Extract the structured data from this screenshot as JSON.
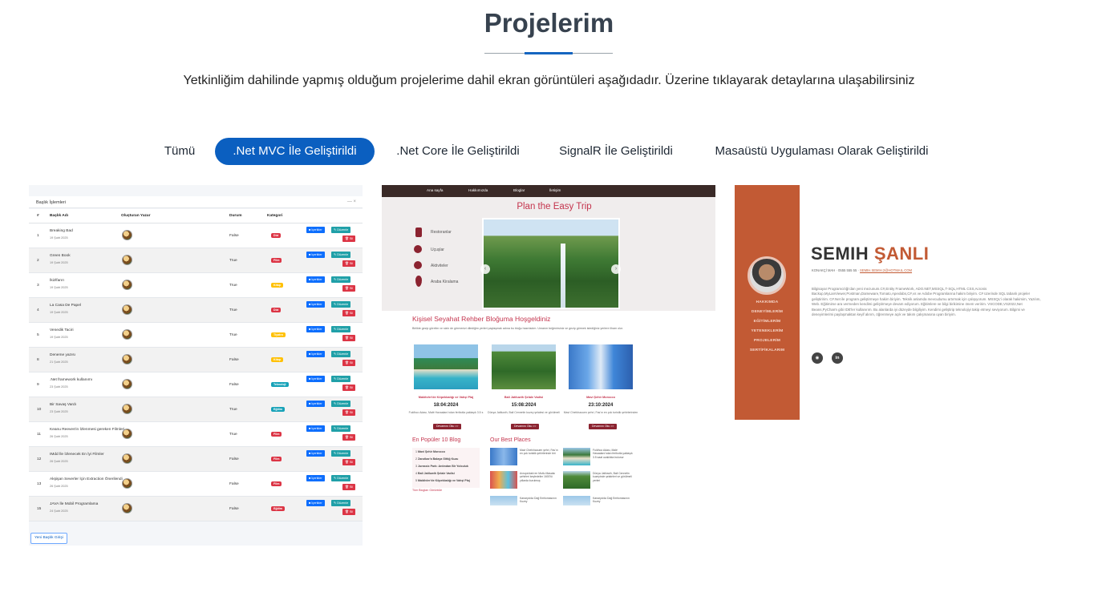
{
  "header": {
    "title": "Projelerim",
    "description": "Yetkinliğim dahilinde yapmış olduğum projelerime dahil ekran görüntüleri aşağıdadır. Üzerine tıklayarak detaylarına ulaşabilirsiniz"
  },
  "colors": {
    "accent": "#0b5fc0",
    "blog_accent": "#c4344d",
    "cv_accent": "#c25a34"
  },
  "filters": [
    {
      "label": "Tümü",
      "active": false
    },
    {
      "label": ".Net MVC İle Geliştirildi",
      "active": true
    },
    {
      "label": ".Net Core İle Geliştirildi",
      "active": false
    },
    {
      "label": "SignalR İle Geliştirildi",
      "active": false
    },
    {
      "label": "Masaüstü Uygulaması Olarak Geliştirildi",
      "active": false
    }
  ],
  "project1": {
    "panel_title": "Başlık İşlemleri",
    "columns": [
      "#",
      "Başlık Adı",
      "Oluşturan Yazar",
      "Durum",
      "Kategori"
    ],
    "rows": [
      {
        "no": "1",
        "title": "Breaking Bad",
        "date": "19 Şubt 2025",
        "status": "False",
        "badge": "Dizi",
        "badge_color": "#dc3545"
      },
      {
        "no": "2",
        "title": "Green Book",
        "date": "19 Şubt 2025",
        "status": "True",
        "badge": "Film",
        "badge_color": "#dc3545"
      },
      {
        "no": "3",
        "title": "İkizlfarırı",
        "date": "19 Şubt 2025",
        "status": "True",
        "badge": "Kitap",
        "badge_color": "#ffc107"
      },
      {
        "no": "4",
        "title": "La Casa De Papel",
        "date": "19 Şubt 2025",
        "status": "True",
        "badge": "Dizi",
        "badge_color": "#dc3545"
      },
      {
        "no": "5",
        "title": "Venedik Taciri",
        "date": "19 Şubt 2025",
        "status": "True",
        "badge": "Tiyatro",
        "badge_color": "#ffc107"
      },
      {
        "no": "8",
        "title": "Deneme yazısı",
        "date": "21 Şubt 2025",
        "status": "False",
        "badge": "Kitap",
        "badge_color": "#ffc107"
      },
      {
        "no": "9",
        "title": ".Net framework kullanımı",
        "date": "23 Şubt 2025",
        "status": "False",
        "badge": "Teknoloji",
        "badge_color": "#17a2b8"
      },
      {
        "no": "10",
        "title": "Bir Savaş Vardı",
        "date": "23 Şubt 2025",
        "status": "True",
        "badge": "Eğitim",
        "badge_color": "#17a2b8"
      },
      {
        "no": "11",
        "title": "Keanu Reeves'in İzlenmesi gereken Filmleri",
        "date": "26 Şubt 2025",
        "status": "True",
        "badge": "Film",
        "badge_color": "#dc3545"
      },
      {
        "no": "12",
        "title": "IMdd İle İzlenecek En İyi Filmler",
        "date": "26 Şubt 2025",
        "status": "False",
        "badge": "Film",
        "badge_color": "#dc3545"
      },
      {
        "no": "13",
        "title": "Akşişan Severler İçin Extraction Önerilendi",
        "date": "26 Şubt 2025",
        "status": "False",
        "badge": "Film",
        "badge_color": "#dc3545"
      },
      {
        "no": "15",
        "title": "JAVA İle Mobil Programlama",
        "date": "24 Şubt 2025",
        "status": "False",
        "badge": "Eğitim",
        "badge_color": "#dc3545"
      }
    ],
    "btn_icerikler": "İçerikler",
    "btn_duzenle": "Düzenle",
    "btn_sil": "Sil",
    "new_button": "Yeni Başlık Girişi"
  },
  "project2": {
    "nav": [
      "Ana sayfa",
      "Hakkımızda",
      "Bloglar",
      "İletişim"
    ],
    "hero_title": "Plan the Easy Trip",
    "menu": [
      "Restoranlar",
      "Uçuşlar",
      "Aktiviteler",
      "Araba Kiralama"
    ],
    "welcome": "Kişisel Seyahat Rehber Bloğuma Hoşgeldiniz",
    "intro": "Birlikte gezip görelim ve sizin de görmenizi dilediğim yerleri paylaşmak adına bu bloğu hazırladım. Umarım beğenirsiniz ve gezip görmek istediğiniz yerlere ilham olur.",
    "posts": [
      {
        "title": "Maldivler'de Köpekbalığı ve Vahşi Plaj",
        "date": "18:04:2024",
        "text": "Fuldhoo Adası, Malé Havaalanı'ndan feribotla yaklaşık 3.5 s",
        "button": "Devamını Oku >>"
      },
      {
        "title": "Bali Jatiluwih Şelale Vadisi",
        "date": "15:08:2024",
        "text": "Dünya Jatiluwih, Bali Cennetin kuzey şelalesi ve görülmeli",
        "button": "Devamını Oku >>"
      },
      {
        "title": "Mavi Şehir Morocco",
        "date": "23:10:2024",
        "text": "Mavi Chefchaouen şehri, Fas'ın en çok turistik şehirlerinden",
        "button": "Devamını Oku >>"
      }
    ],
    "top10_title": "En Popüler 10 Blog",
    "top10": [
      "Mavi Şehir Morocco",
      "Zanzibar'a Balaya Gittiğ Kuzu",
      "Jurassic Park: Ardından Bir Yolculuk",
      "Bali Jatiluwih Şelale Vadisi",
      "Maldivler'de Köpekbalığı ve Vahşi Plaj"
    ],
    "more_link": "Tüm Blogları Görüntüle",
    "places_title": "Our Best Places",
    "places": [
      "Mavi Chefchaouen şehri, Fas'ın en çok turistik şehirlerinde biri",
      "Fuldhoo Adası, Malé Havaalanı'ndan feribotla yaklaşık 3.5 saat uzaklıkta bulunur",
      "Avrupa'daki en Mutlu Masalsı şehirleri keşfedelim 1600'lü yıllarda kurulmuş",
      "Dünya Jatiluwih, Bali Cennetin kuzeyinde şelaleleri ve görülmeli yerleri",
      "Kanarya'da Dağ Emtiomasının Kuzey",
      "Kanarya'da Dağ Emtiomasının Kuzey"
    ]
  },
  "project3": {
    "first_name": "SEMIH",
    "last_name": "ŞANLI",
    "contact_prefix": "KONAKÇİ MAH · 0555 555 55 · ",
    "contact_email": "SEMIH.SEMIH.2@HOTMAIL.COM",
    "nav": [
      "HAKKIMDA",
      "DENEYİMLERİM",
      "EĞİTİMLERİM",
      "YETENEKLERİM",
      "PROJELERİM",
      "SERTİFİKALARIM"
    ],
    "bio": "Bilgisayar Programcılığı'dan yeni mezunum.C#,Entity FrameWork, ADO.NET,MSSQL,T-SQL,HTML CSS,Acronis Backup,MyLanViewer,Postman,Dameware,Tomato,Apexlabs,C#,vs ve Adobe Programlarına hakim biriyim. C# üzerinde SQL tabanlı projeler geliştiririm. C#.Net ile program geliştirmeye hakim biriyim. Teknik anlamda mevcudumu artırmak için çalışıyorum. MSSQL'i olarak hakimim, Yazılım, Web. Eğitimime ara vermeden kendimi geliştirmeye devam ediyorum. Eğitimlere ve bilgi birikimine önem veririm. VSCODE,VS2022,Net Beans,PyCharm gibi IDE'ler kullanırım. Bu alanlarda iyi düzeyde bilgiliyim. Kendimi geliştirip teknolojiyi takip etmeyi seviyorum. Bilgimi ve deneyimlerimi paylaşmaktan keyif alırım, öğrenmeye açık ve takım çalışmasına uyan biriyim.",
    "social": [
      "github-icon",
      "linkedin-icon"
    ]
  }
}
